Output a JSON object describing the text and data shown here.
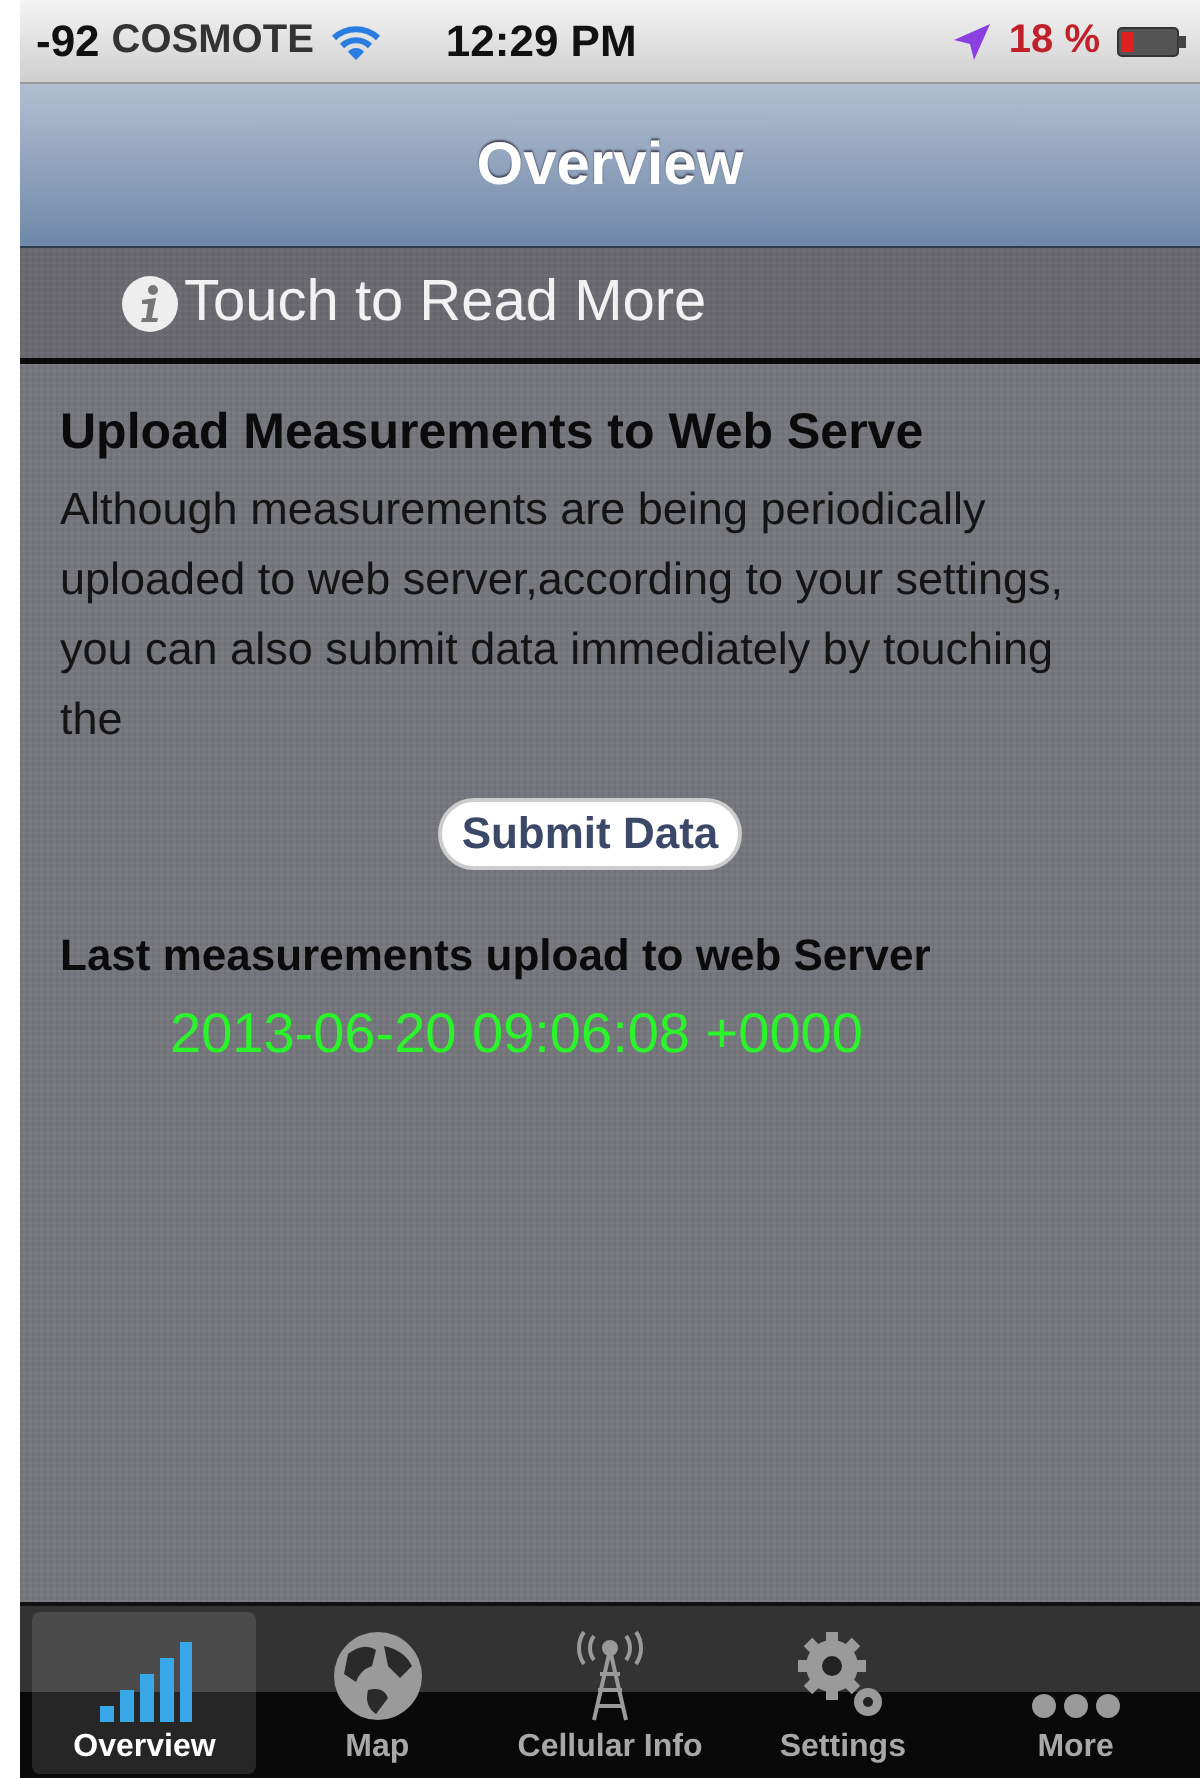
{
  "status_bar": {
    "signal": "-92",
    "carrier": "COSMOTE",
    "time": "12:29 PM",
    "battery": "18 %"
  },
  "nav_bar": {
    "title": "Overview"
  },
  "info_row": {
    "label": "Touch to Read More"
  },
  "upload": {
    "heading": "Upload Measurements to Web Serve",
    "description": "Although measurements are being periodically uploaded to web server,according to your settings, you can also submit data immediately by touching the",
    "button": "Submit Data",
    "last_label": "Last measurements upload to web Server",
    "last_value": "2013-06-20 09:06:08 +0000"
  },
  "tabs": [
    {
      "label": "Overview",
      "kind": "bars",
      "selected": true
    },
    {
      "label": "Map",
      "kind": "globe",
      "selected": false
    },
    {
      "label": "Cellular Info",
      "kind": "tower",
      "selected": false
    },
    {
      "label": "Settings",
      "kind": "gears",
      "selected": false
    },
    {
      "label": "More",
      "kind": "dots",
      "selected": false
    }
  ]
}
